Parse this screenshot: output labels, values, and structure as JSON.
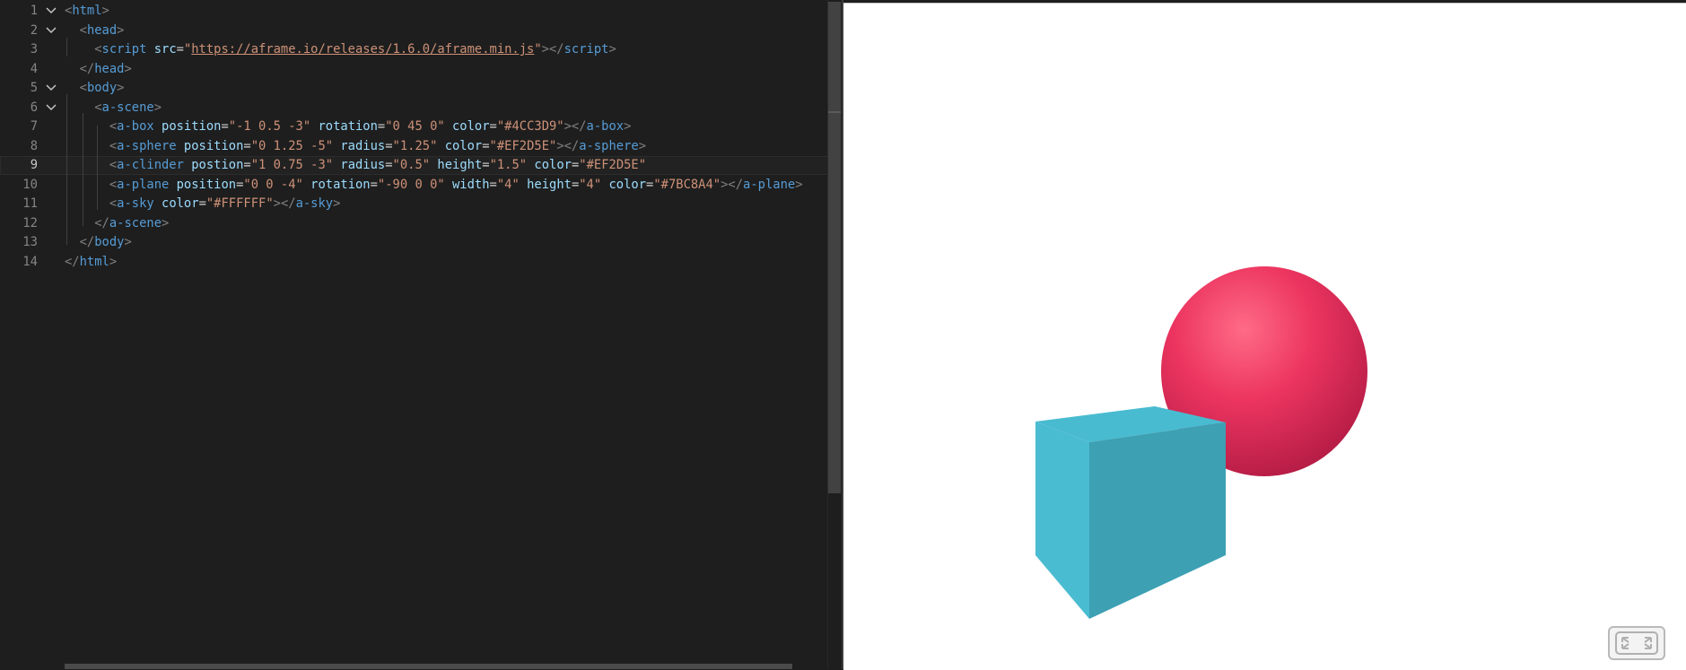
{
  "editor": {
    "current_line": 9,
    "lines": [
      {
        "n": "1",
        "fold": true,
        "tokens": [
          [
            "b",
            "<"
          ],
          [
            "tag",
            "html"
          ],
          [
            "b",
            ">"
          ]
        ]
      },
      {
        "n": "2",
        "fold": true,
        "tokens": [
          [
            "ws",
            "  "
          ],
          [
            "b",
            "<"
          ],
          [
            "tag",
            "head"
          ],
          [
            "b",
            ">"
          ]
        ]
      },
      {
        "n": "3",
        "fold": false,
        "tokens": [
          [
            "ws",
            "    "
          ],
          [
            "b",
            "<"
          ],
          [
            "tag",
            "script"
          ],
          [
            "ws",
            " "
          ],
          [
            "attr",
            "src"
          ],
          [
            "eq",
            "="
          ],
          [
            "str",
            "\""
          ],
          [
            "link",
            "https://aframe.io/releases/1.6.0/aframe.min.js"
          ],
          [
            "str",
            "\""
          ],
          [
            "b",
            "></"
          ],
          [
            "tag",
            "script"
          ],
          [
            "b",
            ">"
          ]
        ]
      },
      {
        "n": "4",
        "fold": false,
        "tokens": [
          [
            "ws",
            "  "
          ],
          [
            "b",
            "</"
          ],
          [
            "tag",
            "head"
          ],
          [
            "b",
            ">"
          ]
        ]
      },
      {
        "n": "5",
        "fold": true,
        "tokens": [
          [
            "ws",
            "  "
          ],
          [
            "b",
            "<"
          ],
          [
            "tag",
            "body"
          ],
          [
            "b",
            ">"
          ]
        ]
      },
      {
        "n": "6",
        "fold": true,
        "tokens": [
          [
            "ws",
            "    "
          ],
          [
            "b",
            "<"
          ],
          [
            "tag",
            "a-scene"
          ],
          [
            "b",
            ">"
          ]
        ]
      },
      {
        "n": "7",
        "fold": false,
        "tokens": [
          [
            "ws",
            "      "
          ],
          [
            "b",
            "<"
          ],
          [
            "tag",
            "a-box"
          ],
          [
            "ws",
            " "
          ],
          [
            "attr",
            "position"
          ],
          [
            "eq",
            "="
          ],
          [
            "str",
            "\"-1 0.5 -3\""
          ],
          [
            "ws",
            " "
          ],
          [
            "attr",
            "rotation"
          ],
          [
            "eq",
            "="
          ],
          [
            "str",
            "\"0 45 0\""
          ],
          [
            "ws",
            " "
          ],
          [
            "attr",
            "color"
          ],
          [
            "eq",
            "="
          ],
          [
            "str",
            "\"#4CC3D9\""
          ],
          [
            "b",
            "></"
          ],
          [
            "tag",
            "a-box"
          ],
          [
            "b",
            ">"
          ]
        ]
      },
      {
        "n": "8",
        "fold": false,
        "tokens": [
          [
            "ws",
            "      "
          ],
          [
            "b",
            "<"
          ],
          [
            "tag",
            "a-sphere"
          ],
          [
            "ws",
            " "
          ],
          [
            "attr",
            "position"
          ],
          [
            "eq",
            "="
          ],
          [
            "str",
            "\"0 1.25 -5\""
          ],
          [
            "ws",
            " "
          ],
          [
            "attr",
            "radius"
          ],
          [
            "eq",
            "="
          ],
          [
            "str",
            "\"1.25\""
          ],
          [
            "ws",
            " "
          ],
          [
            "attr",
            "color"
          ],
          [
            "eq",
            "="
          ],
          [
            "str",
            "\"#EF2D5E\""
          ],
          [
            "b",
            "></"
          ],
          [
            "tag",
            "a-sphere"
          ],
          [
            "b",
            ">"
          ]
        ]
      },
      {
        "n": "9",
        "fold": false,
        "tokens": [
          [
            "ws",
            "      "
          ],
          [
            "b",
            "<"
          ],
          [
            "tag",
            "a-clinder"
          ],
          [
            "ws",
            " "
          ],
          [
            "attr",
            "postion"
          ],
          [
            "eq",
            "="
          ],
          [
            "str",
            "\"1 0.75 -3\""
          ],
          [
            "ws",
            " "
          ],
          [
            "attr",
            "radius"
          ],
          [
            "eq",
            "="
          ],
          [
            "str",
            "\"0.5\""
          ],
          [
            "ws",
            " "
          ],
          [
            "attr",
            "height"
          ],
          [
            "eq",
            "="
          ],
          [
            "str",
            "\"1.5\""
          ],
          [
            "ws",
            " "
          ],
          [
            "attr",
            "color"
          ],
          [
            "eq",
            "="
          ],
          [
            "str",
            "\"#EF2D5E\""
          ]
        ]
      },
      {
        "n": "10",
        "fold": false,
        "tokens": [
          [
            "ws",
            "      "
          ],
          [
            "b",
            "<"
          ],
          [
            "tag",
            "a-plane"
          ],
          [
            "ws",
            " "
          ],
          [
            "attr",
            "position"
          ],
          [
            "eq",
            "="
          ],
          [
            "str",
            "\"0 0 -4\""
          ],
          [
            "ws",
            " "
          ],
          [
            "attr",
            "rotation"
          ],
          [
            "eq",
            "="
          ],
          [
            "str",
            "\"-90 0 0\""
          ],
          [
            "ws",
            " "
          ],
          [
            "attr",
            "width"
          ],
          [
            "eq",
            "="
          ],
          [
            "str",
            "\"4\""
          ],
          [
            "ws",
            " "
          ],
          [
            "attr",
            "height"
          ],
          [
            "eq",
            "="
          ],
          [
            "str",
            "\"4\""
          ],
          [
            "ws",
            " "
          ],
          [
            "attr",
            "color"
          ],
          [
            "eq",
            "="
          ],
          [
            "str",
            "\"#7BC8A4\""
          ],
          [
            "b",
            "></"
          ],
          [
            "tag",
            "a-plane"
          ],
          [
            "b",
            ">"
          ]
        ]
      },
      {
        "n": "11",
        "fold": false,
        "tokens": [
          [
            "ws",
            "      "
          ],
          [
            "b",
            "<"
          ],
          [
            "tag",
            "a-sky"
          ],
          [
            "ws",
            " "
          ],
          [
            "attr",
            "color"
          ],
          [
            "eq",
            "="
          ],
          [
            "str",
            "\"#FFFFFF\""
          ],
          [
            "b",
            "></"
          ],
          [
            "tag",
            "a-sky"
          ],
          [
            "b",
            ">"
          ]
        ]
      },
      {
        "n": "12",
        "fold": false,
        "tokens": [
          [
            "ws",
            "    "
          ],
          [
            "b",
            "</"
          ],
          [
            "tag",
            "a-scene"
          ],
          [
            "b",
            ">"
          ]
        ]
      },
      {
        "n": "13",
        "fold": false,
        "tokens": [
          [
            "ws",
            "  "
          ],
          [
            "b",
            "</"
          ],
          [
            "tag",
            "body"
          ],
          [
            "b",
            ">"
          ]
        ]
      },
      {
        "n": "14",
        "fold": false,
        "tokens": [
          [
            "b",
            "</"
          ],
          [
            "tag",
            "html"
          ],
          [
            "b",
            ">"
          ]
        ]
      }
    ]
  },
  "preview": {
    "background": "#FFFFFF",
    "sphere_color": "#EF2D5E",
    "box_color": "#4CC3D9",
    "vr_button_icon": "fullscreen-icon"
  }
}
